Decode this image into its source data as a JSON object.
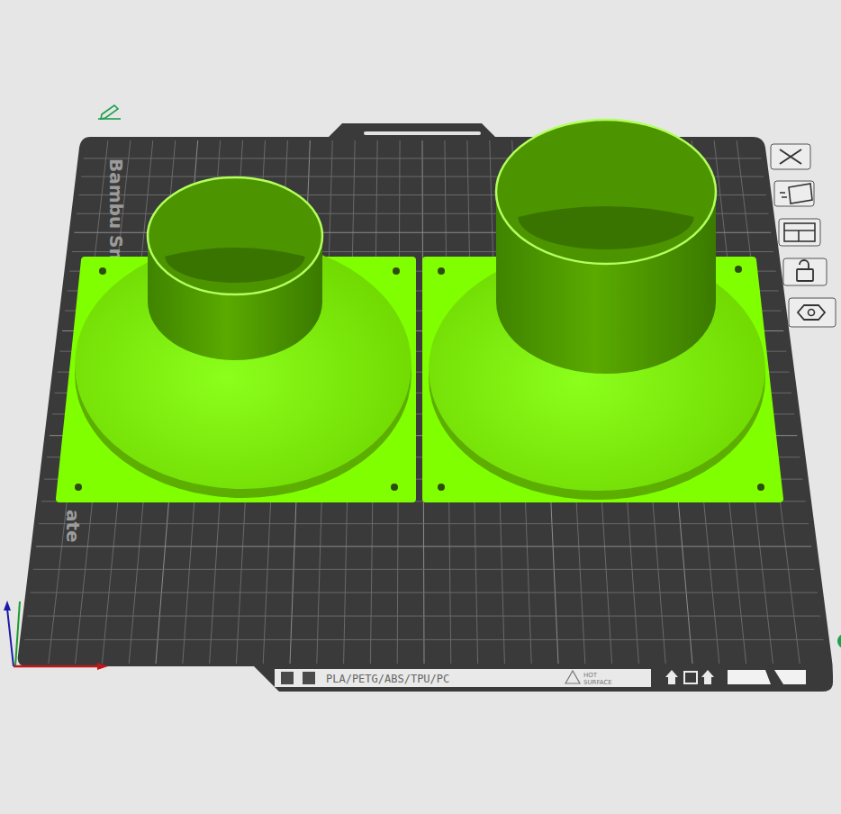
{
  "plate": {
    "label_parts": [
      "Bambu Smo",
      "ate"
    ],
    "filament_label": "PLA/PETG/ABS/TPU/PC",
    "warning": {
      "lines": [
        "HOT",
        "SURFACE"
      ]
    }
  },
  "objects": [
    {
      "selected": true
    },
    {
      "selected": true
    }
  ]
}
